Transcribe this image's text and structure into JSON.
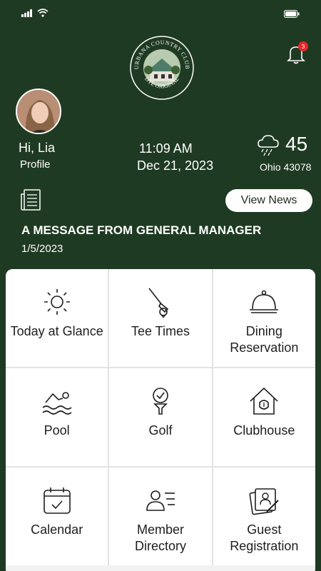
{
  "notifications": {
    "count": "3"
  },
  "logo": {
    "text_top": "URBANA COUNTRY CLUB",
    "text_bottom": "DYE ORIGINAL"
  },
  "profile": {
    "greeting": "Hi, Lia",
    "link_label": "Profile"
  },
  "clock": {
    "time": "11:09 AM",
    "date": "Dec 21, 2023"
  },
  "weather": {
    "temperature": "45",
    "location": "Ohio 43078",
    "icon": "rain-cloud-icon"
  },
  "news": {
    "button_label": "View News",
    "title": "A MESSAGE FROM GENERAL MANAGER",
    "date": "1/5/2023"
  },
  "menu": {
    "tiles": [
      {
        "label": "Today at Glance",
        "icon": "sun-icon"
      },
      {
        "label": "Tee Times",
        "icon": "golf-club-icon"
      },
      {
        "label": "Dining Reservation",
        "icon": "cloche-icon"
      },
      {
        "label": "Pool",
        "icon": "swimmer-icon"
      },
      {
        "label": "Golf",
        "icon": "golf-ball-tee-icon"
      },
      {
        "label": "Clubhouse",
        "icon": "clubhouse-icon"
      },
      {
        "label": "Calendar",
        "icon": "calendar-icon"
      },
      {
        "label": "Member Directory",
        "icon": "directory-icon"
      },
      {
        "label": "Guest Registration",
        "icon": "guest-card-icon"
      }
    ]
  },
  "colors": {
    "background": "#1f3a22",
    "badge": "#e8262b",
    "tile_bg": "#ffffff"
  }
}
